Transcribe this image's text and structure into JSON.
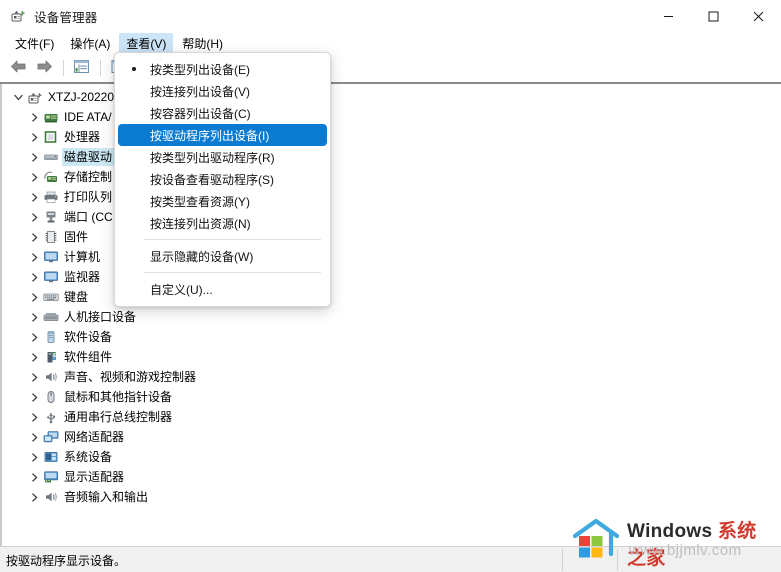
{
  "window": {
    "title": "设备管理器",
    "icon": "device-manager-icon",
    "controls": [
      {
        "name": "minimize-button",
        "glyph": "minimize-icon"
      },
      {
        "name": "maximize-button",
        "glyph": "maximize-icon"
      },
      {
        "name": "close-button",
        "glyph": "close-icon"
      }
    ]
  },
  "menubar": {
    "items": [
      {
        "label": "文件(F)",
        "name": "menubar-item-file",
        "active": false
      },
      {
        "label": "操作(A)",
        "name": "menubar-item-action",
        "active": false
      },
      {
        "label": "查看(V)",
        "name": "menubar-item-view",
        "active": true
      },
      {
        "label": "帮助(H)",
        "name": "menubar-item-help",
        "active": false
      }
    ]
  },
  "toolbar": {
    "buttons": [
      {
        "name": "back-button",
        "icon": "arrow-left-icon"
      },
      {
        "name": "forward-button",
        "icon": "arrow-right-icon"
      },
      {
        "name": "show-hide-console-tree-button",
        "icon": "console-tree-icon"
      },
      {
        "name": "properties-button",
        "icon": "properties-icon"
      }
    ]
  },
  "view_menu": {
    "items": [
      {
        "label": "按类型列出设备(E)",
        "name": "menu-item-devices-by-type",
        "bullet": true,
        "selected": false,
        "separator_before": false
      },
      {
        "label": "按连接列出设备(V)",
        "name": "menu-item-devices-by-connection",
        "bullet": false,
        "selected": false,
        "separator_before": false
      },
      {
        "label": "按容器列出设备(C)",
        "name": "menu-item-devices-by-container",
        "bullet": false,
        "selected": false,
        "separator_before": false
      },
      {
        "label": "按驱动程序列出设备(I)",
        "name": "menu-item-devices-by-driver",
        "bullet": false,
        "selected": true,
        "separator_before": false
      },
      {
        "label": "按类型列出驱动程序(R)",
        "name": "menu-item-drivers-by-type",
        "bullet": false,
        "selected": false,
        "separator_before": false
      },
      {
        "label": "按设备查看驱动程序(S)",
        "name": "menu-item-drivers-by-device",
        "bullet": false,
        "selected": false,
        "separator_before": false
      },
      {
        "label": "按类型查看资源(Y)",
        "name": "menu-item-resources-by-type",
        "bullet": false,
        "selected": false,
        "separator_before": false
      },
      {
        "label": "按连接列出资源(N)",
        "name": "menu-item-resources-by-connection",
        "bullet": false,
        "selected": false,
        "separator_before": false
      },
      {
        "label": "显示隐藏的设备(W)",
        "name": "menu-item-show-hidden-devices",
        "bullet": false,
        "selected": false,
        "separator_before": true
      },
      {
        "label": "自定义(U)...",
        "name": "menu-item-customize",
        "bullet": false,
        "selected": false,
        "separator_before": true
      }
    ]
  },
  "tree": {
    "root": {
      "label": "XTZJ-20220",
      "name": "tree-root-computer",
      "icon": "computer-icon",
      "expanded": true
    },
    "items": [
      {
        "label": "IDE ATA/",
        "name": "tree-item-ide-ata",
        "icon": "ide-controller-icon",
        "selected": false
      },
      {
        "label": "处理器",
        "name": "tree-item-processors",
        "icon": "processor-icon",
        "selected": false
      },
      {
        "label": "磁盘驱动",
        "name": "tree-item-disk-drives",
        "icon": "disk-drive-icon",
        "selected": true
      },
      {
        "label": "存储控制",
        "name": "tree-item-storage-controllers",
        "icon": "storage-controller-icon",
        "selected": false
      },
      {
        "label": "打印队列",
        "name": "tree-item-print-queues",
        "icon": "printer-icon",
        "selected": false
      },
      {
        "label": "端口 (CC",
        "name": "tree-item-ports",
        "icon": "port-icon",
        "selected": false
      },
      {
        "label": "固件",
        "name": "tree-item-firmware",
        "icon": "firmware-icon",
        "selected": false
      },
      {
        "label": "计算机",
        "name": "tree-item-computer",
        "icon": "monitor-icon",
        "selected": false
      },
      {
        "label": "监视器",
        "name": "tree-item-monitors",
        "icon": "monitor-icon",
        "selected": false
      },
      {
        "label": "键盘",
        "name": "tree-item-keyboards",
        "icon": "keyboard-icon",
        "selected": false
      },
      {
        "label": "人机接口设备",
        "name": "tree-item-hid",
        "icon": "hid-icon",
        "selected": false
      },
      {
        "label": "软件设备",
        "name": "tree-item-software-devices",
        "icon": "software-device-icon",
        "selected": false
      },
      {
        "label": "软件组件",
        "name": "tree-item-software-components",
        "icon": "software-component-icon",
        "selected": false
      },
      {
        "label": "声音、视频和游戏控制器",
        "name": "tree-item-sound-video-game",
        "icon": "speaker-icon",
        "selected": false
      },
      {
        "label": "鼠标和其他指针设备",
        "name": "tree-item-mice",
        "icon": "mouse-icon",
        "selected": false
      },
      {
        "label": "通用串行总线控制器",
        "name": "tree-item-usb-controllers",
        "icon": "usb-icon",
        "selected": false
      },
      {
        "label": "网络适配器",
        "name": "tree-item-network-adapters",
        "icon": "network-adapter-icon",
        "selected": false
      },
      {
        "label": "系统设备",
        "name": "tree-item-system-devices",
        "icon": "system-device-icon",
        "selected": false
      },
      {
        "label": "显示适配器",
        "name": "tree-item-display-adapters",
        "icon": "display-adapter-icon",
        "selected": false
      },
      {
        "label": "音频输入和输出",
        "name": "tree-item-audio-io",
        "icon": "speaker-icon",
        "selected": false
      }
    ]
  },
  "statusbar": {
    "text": "按驱动程序显示设备。"
  },
  "watermark": {
    "brand": "Windows ",
    "brand_cn": "系统之家",
    "url": "www.bjjmlv.com"
  },
  "colors": {
    "menu_highlight": "#0b7ad1",
    "menubar_active": "#cce4f7",
    "tree_selected": "#cce8f4",
    "statusbar_bg": "#f0f0f0"
  }
}
